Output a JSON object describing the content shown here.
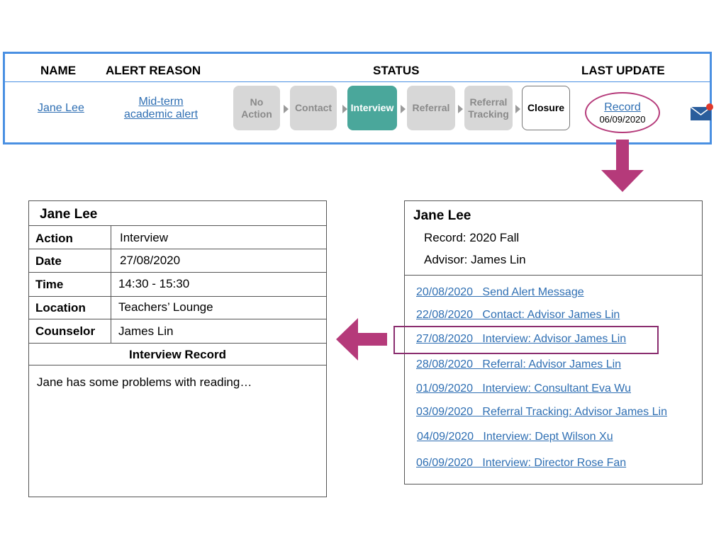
{
  "alert_table": {
    "headers": {
      "name": "NAME",
      "alert_reason": "ALERT REASON",
      "status": "STATUS",
      "last_update": "LAST UPDATE"
    },
    "row": {
      "name": "Jane Lee",
      "alert_reason_line1": "Mid-term",
      "alert_reason_line2": "academic alert",
      "status_steps": [
        {
          "line1": "No",
          "line2": "Action",
          "state": "inactive"
        },
        {
          "line1": "Contact",
          "line2": "",
          "state": "inactive"
        },
        {
          "line1": "Interview",
          "line2": "",
          "state": "active"
        },
        {
          "line1": "Referral",
          "line2": "",
          "state": "inactive"
        },
        {
          "line1": "Referral",
          "line2": "Tracking",
          "state": "inactive"
        },
        {
          "line1": "Closure",
          "line2": "",
          "state": "outlined"
        }
      ],
      "record_link": "Record",
      "record_date": "06/09/2020",
      "mail_icon": "envelope-icon",
      "notification_color": "#e0392b"
    }
  },
  "detail_panel": {
    "student_name": "Jane Lee",
    "fields": [
      {
        "label": "Action",
        "value": "Interview"
      },
      {
        "label": "Date",
        "value": "27/08/2020"
      },
      {
        "label": "Time",
        "value": "14:30 - 15:30"
      },
      {
        "label": "Location",
        "value": "Teachers’ Lounge"
      },
      {
        "label": "Counselor",
        "value": "James Lin"
      }
    ],
    "section_title": "Interview Record",
    "notes": "Jane has some problems with reading…"
  },
  "record_panel": {
    "student_name": "Jane Lee",
    "record": "Record: 2020 Fall",
    "advisor": "Advisor: James Lin",
    "entries": [
      "20/08/2020   Send Alert Message",
      "22/08/2020   Contact: Advisor James Lin",
      "27/08/2020   Interview: Advisor James Lin",
      "28/08/2020   Referral: Advisor James Lin",
      "01/09/2020   Interview: Consultant Eva Wu",
      "03/09/2020   Referral Tracking: Advisor James Lin",
      "04/09/2020   Interview: Dept Wilson Xu",
      "06/09/2020   Interview: Director Rose Fan"
    ],
    "highlighted_entry_index": 2
  },
  "colors": {
    "table_border": "#4a90e2",
    "active_step": "#4aa79b",
    "inactive_step": "#d7d7d7",
    "arrow": "#b53a7a",
    "highlight": "#8a2d6f",
    "link": "#2f6fb3"
  }
}
